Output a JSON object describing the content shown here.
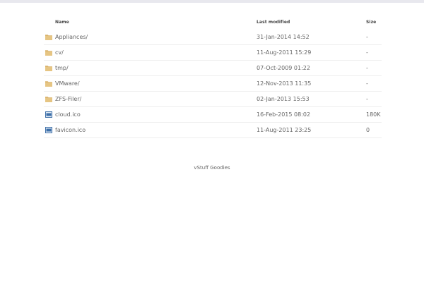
{
  "header": {
    "name": "Name",
    "last_modified": "Last modified",
    "size": "Size"
  },
  "rows": [
    {
      "name": "Appliances/",
      "modified": "31-Jan-2014 14:52",
      "size": "-",
      "icon": "folder-icon"
    },
    {
      "name": "cv/",
      "modified": "11-Aug-2011 15:29",
      "size": "-",
      "icon": "folder-icon"
    },
    {
      "name": "tmp/",
      "modified": "07-Oct-2009 01:22",
      "size": "-",
      "icon": "folder-icon"
    },
    {
      "name": "VMware/",
      "modified": "12-Nov-2013 11:35",
      "size": "-",
      "icon": "folder-icon"
    },
    {
      "name": "ZFS-Filer/",
      "modified": "02-Jan-2013 15:53",
      "size": "-",
      "icon": "folder-icon"
    },
    {
      "name": "cloud.ico",
      "modified": "16-Feb-2015 08:02",
      "size": "180K",
      "icon": "image-file-icon"
    },
    {
      "name": "favicon.ico",
      "modified": "11-Aug-2011 23:25",
      "size": "0",
      "icon": "image-file-icon"
    }
  ],
  "footer": {
    "text": "vStuff Goodies"
  },
  "colors": {
    "folder": "#d9b26b",
    "file": "#3d6fa8"
  }
}
